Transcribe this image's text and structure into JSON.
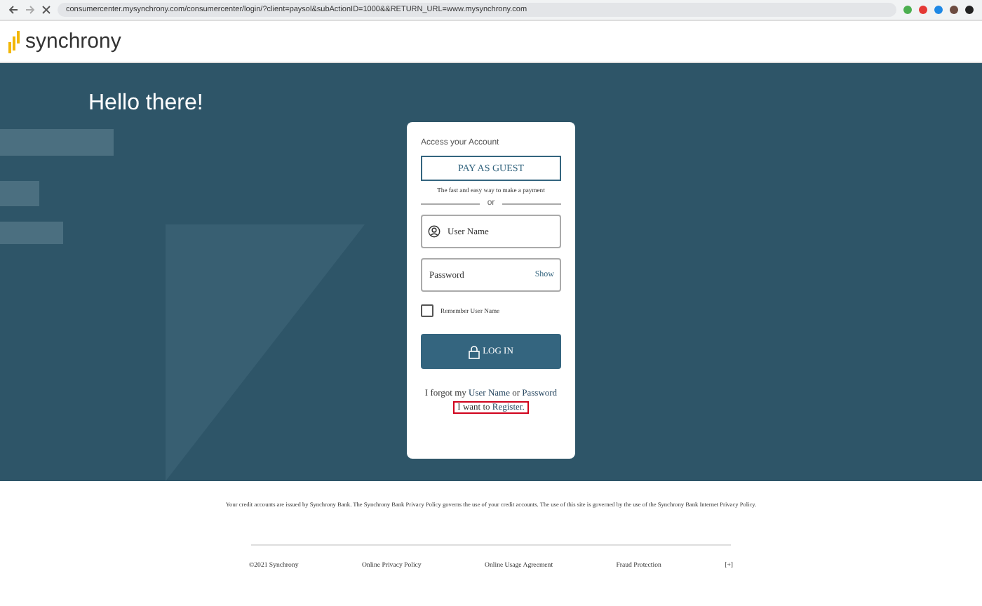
{
  "browser": {
    "url": "consumercenter.mysynchrony.com/consumercenter/login/?client=paysol&subActionID=1000&&RETURN_URL=www.mysynchrony.com"
  },
  "header": {
    "logo": "synchrony"
  },
  "hero": {
    "greeting": "Hello there!"
  },
  "login_card": {
    "title": "Access your Account",
    "guest_button": "PAY AS GUEST",
    "guest_caption": "The fast and easy way to make a payment",
    "divider": "or",
    "username": {
      "placeholder": "User Name"
    },
    "password": {
      "placeholder": "Password",
      "toggle": "Show"
    },
    "remember": {
      "label": "Remember User Name",
      "checked": false
    },
    "login_button": "LOG IN",
    "forgot": {
      "prefix": "I forgot my",
      "user_link": "User Name",
      "middle": "or",
      "password_link": "Password"
    },
    "register": {
      "prefix": "I want to",
      "link": "Register."
    }
  },
  "footer": {
    "disclaimer": "Your credit accounts are issued by Synchrony Bank. The Synchrony Bank Privacy Policy governs the use of your credit accounts. The use of this site is governed by the use of the Synchrony Bank Internet Privacy Policy.",
    "copyright": "©2021 Synchrony",
    "links": [
      "Online Privacy Policy",
      "Online Usage Agreement",
      "Fraud Protection"
    ],
    "expand": "[+]"
  }
}
